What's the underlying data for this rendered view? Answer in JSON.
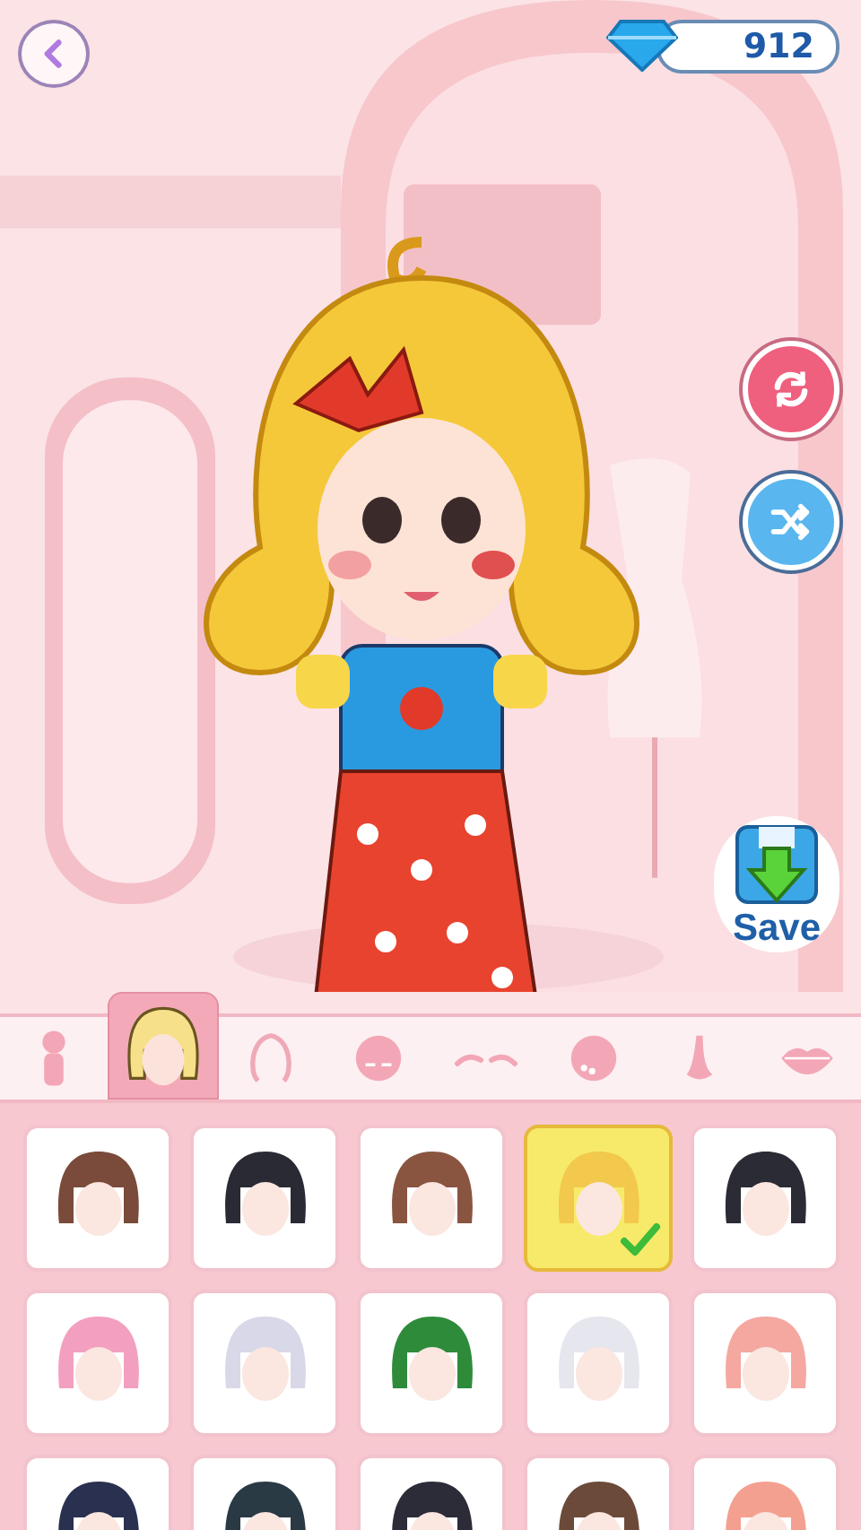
{
  "currency": {
    "amount": "912"
  },
  "save_button": {
    "label": "Save"
  },
  "tabs": [
    {
      "kind": "body",
      "selected": false
    },
    {
      "kind": "hair",
      "selected": true
    },
    {
      "kind": "back-hair",
      "selected": false
    },
    {
      "kind": "eyes",
      "selected": false
    },
    {
      "kind": "eyebrows",
      "selected": false
    },
    {
      "kind": "blush",
      "selected": false
    },
    {
      "kind": "nose",
      "selected": false
    },
    {
      "kind": "lips",
      "selected": false
    }
  ],
  "items": [
    {
      "color": "#7a4a3a",
      "selected": false
    },
    {
      "color": "#2a2a35",
      "selected": false
    },
    {
      "color": "#8a5540",
      "selected": false
    },
    {
      "color": "#f2c94c",
      "selected": true
    },
    {
      "color": "#2b2b36",
      "selected": false
    },
    {
      "color": "#f3a0c0",
      "selected": false
    },
    {
      "color": "#d8d8e8",
      "selected": false
    },
    {
      "color": "#2e8b3a",
      "selected": false
    },
    {
      "color": "#e6e6ee",
      "selected": false
    },
    {
      "color": "#f4a8a0",
      "selected": false
    },
    {
      "color": "#2a3050",
      "selected": false
    },
    {
      "color": "#2a3a45",
      "selected": false
    },
    {
      "color": "#2c2c38",
      "selected": false
    },
    {
      "color": "#6b4a3a",
      "selected": false
    },
    {
      "color": "#f4a090",
      "selected": false
    }
  ]
}
